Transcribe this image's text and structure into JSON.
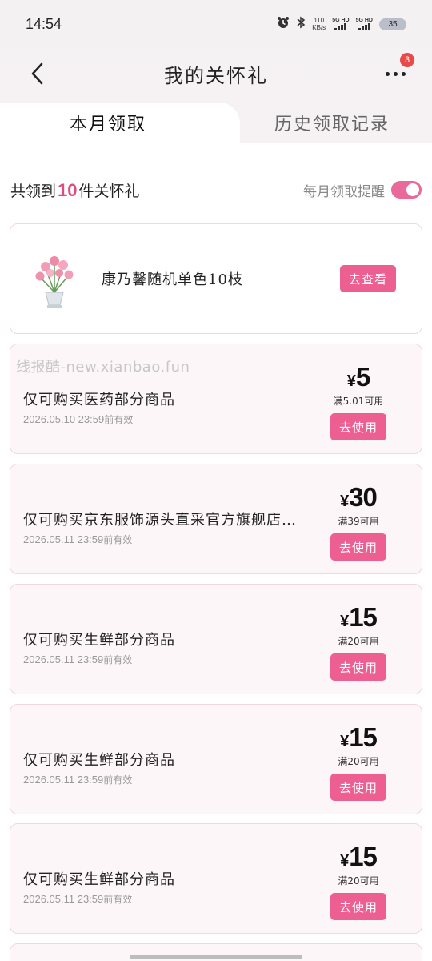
{
  "status_bar": {
    "time": "14:54",
    "net_speed_value": "110",
    "net_speed_unit": "KB/s",
    "sim1": "5G HD",
    "sim2": "5G HD",
    "battery": "35"
  },
  "header": {
    "title": "我的关怀礼",
    "more_badge": "3"
  },
  "tabs": [
    {
      "label": "本月领取",
      "active": true
    },
    {
      "label": "历史领取记录",
      "active": false
    }
  ],
  "summary": {
    "prefix": "共领到",
    "count": "10",
    "suffix": "件关怀礼",
    "reminder_label": "每月领取提醒",
    "reminder_on": true
  },
  "gift": {
    "name": "康乃馨随机单色10枝",
    "button": "去查看"
  },
  "watermark": "线报酷-new.xianbao.fun",
  "coupons": [
    {
      "desc": "仅可购买医药部分商品",
      "date": "2026.05.10 23:59",
      "date_suffix": "前有效",
      "currency": "¥",
      "amount": "5",
      "condition": "满5.01可用",
      "button": "去使用"
    },
    {
      "desc": "仅可购买京东服饰源头直采官方旗舰店…",
      "date": "2026.05.11 23:59",
      "date_suffix": "前有效",
      "currency": "¥",
      "amount": "30",
      "condition": "满39可用",
      "button": "去使用"
    },
    {
      "desc": "仅可购买生鲜部分商品",
      "date": "2026.05.11 23:59",
      "date_suffix": "前有效",
      "currency": "¥",
      "amount": "15",
      "condition": "满20可用",
      "button": "去使用"
    },
    {
      "desc": "仅可购买生鲜部分商品",
      "date": "2026.05.11 23:59",
      "date_suffix": "前有效",
      "currency": "¥",
      "amount": "15",
      "condition": "满20可用",
      "button": "去使用"
    },
    {
      "desc": "仅可购买生鲜部分商品",
      "date": "2026.05.11 23:59",
      "date_suffix": "前有效",
      "currency": "¥",
      "amount": "15",
      "condition": "满20可用",
      "button": "去使用"
    }
  ],
  "colors": {
    "accent": "#ec5f90",
    "count_highlight": "#e2497c",
    "card_border": "#f0d6df",
    "coupon_bg": "#fdf6f8",
    "header_bg": "#f4f1f3",
    "badge": "#e84a4a"
  }
}
